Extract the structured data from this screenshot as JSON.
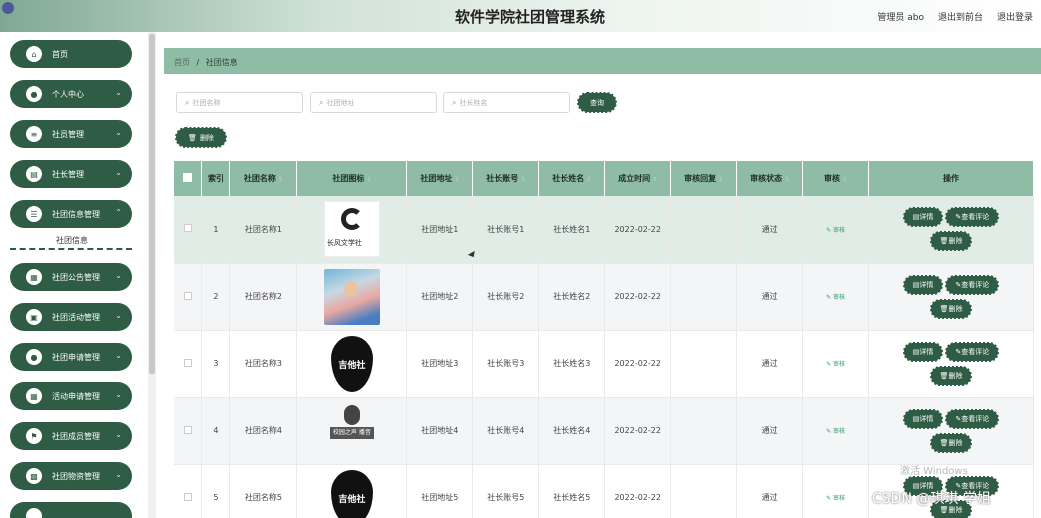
{
  "header": {
    "title": "软件学院社团管理系统",
    "admin": "管理员 abo",
    "back_front": "退出到前台",
    "logout": "退出登录"
  },
  "sidebar": {
    "items": [
      {
        "label": "首页",
        "icon": "home-icon",
        "glyph": "⌂",
        "chevron": false
      },
      {
        "label": "个人中心",
        "icon": "user-icon",
        "glyph": "●",
        "chevron": true
      },
      {
        "label": "社员管理",
        "icon": "sliders-icon",
        "glyph": "≡",
        "chevron": true
      },
      {
        "label": "社长管理",
        "icon": "document-icon",
        "glyph": "▤",
        "chevron": true
      },
      {
        "label": "社团信息管理",
        "icon": "list-icon",
        "glyph": "☰",
        "chevron": true
      },
      {
        "label": "社团公告管理",
        "icon": "grid-icon",
        "glyph": "▦",
        "chevron": true
      },
      {
        "label": "社团活动管理",
        "icon": "clipboard-icon",
        "glyph": "▣",
        "chevron": true
      },
      {
        "label": "社团申请管理",
        "icon": "user-icon",
        "glyph": "●",
        "chevron": true
      },
      {
        "label": "活动申请管理",
        "icon": "grid-icon",
        "glyph": "▦",
        "chevron": true
      },
      {
        "label": "社团成员管理",
        "icon": "flag-icon",
        "glyph": "⚑",
        "chevron": true
      },
      {
        "label": "社团物资管理",
        "icon": "box-icon",
        "glyph": "▩",
        "chevron": true
      }
    ],
    "submenu": "社团信息"
  },
  "breadcrumb": {
    "home": "首页",
    "sep": "/",
    "current": "社团信息"
  },
  "search": {
    "name_placeholder": "社团名称",
    "address_placeholder": "社团地址",
    "leader_placeholder": "社长姓名",
    "query_label": "查询",
    "delete_label": "删除"
  },
  "table": {
    "headers": [
      "索引",
      "社团名称",
      "社团图标",
      "社团地址",
      "社长账号",
      "社长姓名",
      "成立时间",
      "审核回复",
      "审核状态",
      "审核",
      "操作"
    ],
    "rows": [
      {
        "index": "1",
        "name": "社团名称1",
        "logo": "ink-logo",
        "logo_text": "长风文学社",
        "address": "社团地址1",
        "account": "社长账号1",
        "leader": "社长姓名1",
        "date": "2022-02-22",
        "reply": "",
        "status": "通过",
        "audit": "审核"
      },
      {
        "index": "2",
        "name": "社团名称2",
        "logo": "photo-logo",
        "logo_text": "",
        "address": "社团地址2",
        "account": "社长账号2",
        "leader": "社长姓名2",
        "date": "2022-02-22",
        "reply": "",
        "status": "通过",
        "audit": "审核"
      },
      {
        "index": "3",
        "name": "社团名称3",
        "logo": "guitar-pick-logo",
        "logo_text": "吉他社",
        "address": "社团地址3",
        "account": "社长账号3",
        "leader": "社长姓名3",
        "date": "2022-02-22",
        "reply": "",
        "status": "通过",
        "audit": "审核"
      },
      {
        "index": "4",
        "name": "社团名称4",
        "logo": "mic-logo",
        "logo_text": "校园之声 播音",
        "address": "社团地址4",
        "account": "社长账号4",
        "leader": "社长姓名4",
        "date": "2022-02-22",
        "reply": "",
        "status": "通过",
        "audit": "审核"
      },
      {
        "index": "5",
        "name": "社团名称5",
        "logo": "guitar-pick-logo",
        "logo_text": "吉他社",
        "address": "社团地址5",
        "account": "社长账号5",
        "leader": "社长姓名5",
        "date": "2022-02-22",
        "reply": "",
        "status": "通过",
        "audit": "审核"
      }
    ],
    "ops": {
      "detail": "详情",
      "comments": "查看评论",
      "delete": "删除"
    }
  },
  "overlay": {
    "watermark": "激活 Windows",
    "csdn": "CSDN @琪琪 学姐"
  },
  "colors": {
    "primary": "#2f5c45",
    "header_bg": "#8fbca5",
    "row_highlight": "#e1ece6"
  }
}
